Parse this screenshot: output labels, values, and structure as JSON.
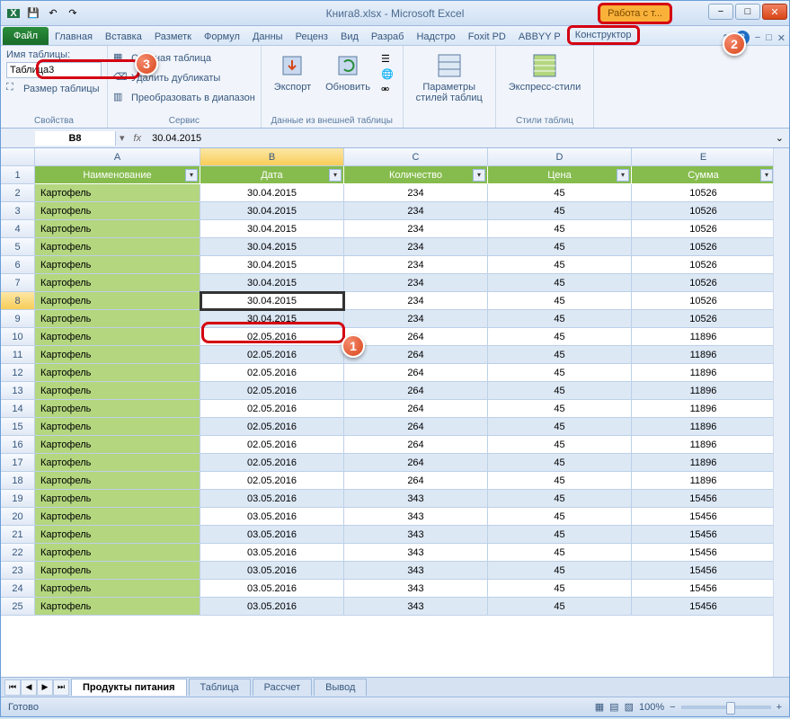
{
  "title": "Книга8.xlsx - Microsoft Excel",
  "context_title": "Работа с т...",
  "qat": {
    "save": "💾",
    "undo": "↶",
    "redo": "↷"
  },
  "win": {
    "min": "−",
    "max": "□",
    "close": "✕"
  },
  "tabs": {
    "file": "Файл",
    "items": [
      "Главная",
      "Вставка",
      "Разметк",
      "Формул",
      "Данны",
      "Реценз",
      "Вид",
      "Разраб",
      "Надстро",
      "Foxit PD",
      "ABBYY P"
    ],
    "context": "Конструктор"
  },
  "ribbon": {
    "props": {
      "label": "Имя таблицы:",
      "name": "Таблица3",
      "resize": "Размер таблицы",
      "group": "Свойства"
    },
    "tools": {
      "pivot": "Сводная таблица",
      "dup": "Удалить дубликаты",
      "range": "Преобразовать в диапазон",
      "group": "Сервис"
    },
    "ext": {
      "export": "Экспорт",
      "refresh": "Обновить",
      "group": "Данные из внешней таблицы"
    },
    "opts": {
      "params": "Параметры\nстилей таблиц"
    },
    "styles": {
      "express": "Экспресс-стили",
      "group": "Стили таблиц"
    }
  },
  "namebox": {
    "cell": "B8",
    "fx": "fx",
    "value": "30.04.2015"
  },
  "columns": [
    "",
    "A",
    "B",
    "C",
    "D",
    "E"
  ],
  "headers": [
    "Наименование",
    "Дата",
    "Количество",
    "Цена",
    "Сумма"
  ],
  "rows": [
    {
      "n": 2,
      "name": "Картофель",
      "date": "30.04.2015",
      "qty": "234",
      "price": "45",
      "sum": "10526"
    },
    {
      "n": 3,
      "name": "Картофель",
      "date": "30.04.2015",
      "qty": "234",
      "price": "45",
      "sum": "10526"
    },
    {
      "n": 4,
      "name": "Картофель",
      "date": "30.04.2015",
      "qty": "234",
      "price": "45",
      "sum": "10526"
    },
    {
      "n": 5,
      "name": "Картофель",
      "date": "30.04.2015",
      "qty": "234",
      "price": "45",
      "sum": "10526"
    },
    {
      "n": 6,
      "name": "Картофель",
      "date": "30.04.2015",
      "qty": "234",
      "price": "45",
      "sum": "10526"
    },
    {
      "n": 7,
      "name": "Картофель",
      "date": "30.04.2015",
      "qty": "234",
      "price": "45",
      "sum": "10526"
    },
    {
      "n": 8,
      "name": "Картофель",
      "date": "30.04.2015",
      "qty": "234",
      "price": "45",
      "sum": "10526",
      "selected": true
    },
    {
      "n": 9,
      "name": "Картофель",
      "date": "30.04.2015",
      "qty": "234",
      "price": "45",
      "sum": "10526"
    },
    {
      "n": 10,
      "name": "Картофель",
      "date": "02.05.2016",
      "qty": "264",
      "price": "45",
      "sum": "11896"
    },
    {
      "n": 11,
      "name": "Картофель",
      "date": "02.05.2016",
      "qty": "264",
      "price": "45",
      "sum": "11896"
    },
    {
      "n": 12,
      "name": "Картофель",
      "date": "02.05.2016",
      "qty": "264",
      "price": "45",
      "sum": "11896"
    },
    {
      "n": 13,
      "name": "Картофель",
      "date": "02.05.2016",
      "qty": "264",
      "price": "45",
      "sum": "11896"
    },
    {
      "n": 14,
      "name": "Картофель",
      "date": "02.05.2016",
      "qty": "264",
      "price": "45",
      "sum": "11896"
    },
    {
      "n": 15,
      "name": "Картофель",
      "date": "02.05.2016",
      "qty": "264",
      "price": "45",
      "sum": "11896"
    },
    {
      "n": 16,
      "name": "Картофель",
      "date": "02.05.2016",
      "qty": "264",
      "price": "45",
      "sum": "11896"
    },
    {
      "n": 17,
      "name": "Картофель",
      "date": "02.05.2016",
      "qty": "264",
      "price": "45",
      "sum": "11896"
    },
    {
      "n": 18,
      "name": "Картофель",
      "date": "02.05.2016",
      "qty": "264",
      "price": "45",
      "sum": "11896"
    },
    {
      "n": 19,
      "name": "Картофель",
      "date": "03.05.2016",
      "qty": "343",
      "price": "45",
      "sum": "15456"
    },
    {
      "n": 20,
      "name": "Картофель",
      "date": "03.05.2016",
      "qty": "343",
      "price": "45",
      "sum": "15456"
    },
    {
      "n": 21,
      "name": "Картофель",
      "date": "03.05.2016",
      "qty": "343",
      "price": "45",
      "sum": "15456"
    },
    {
      "n": 22,
      "name": "Картофель",
      "date": "03.05.2016",
      "qty": "343",
      "price": "45",
      "sum": "15456"
    },
    {
      "n": 23,
      "name": "Картофель",
      "date": "03.05.2016",
      "qty": "343",
      "price": "45",
      "sum": "15456"
    },
    {
      "n": 24,
      "name": "Картофель",
      "date": "03.05.2016",
      "qty": "343",
      "price": "45",
      "sum": "15456"
    },
    {
      "n": 25,
      "name": "Картофель",
      "date": "03.05.2016",
      "qty": "343",
      "price": "45",
      "sum": "15456"
    }
  ],
  "sheets": {
    "active": "Продукты питания",
    "others": [
      "Таблица",
      "Рассчет",
      "Вывод"
    ]
  },
  "status": {
    "ready": "Готово",
    "zoom": "100%"
  }
}
